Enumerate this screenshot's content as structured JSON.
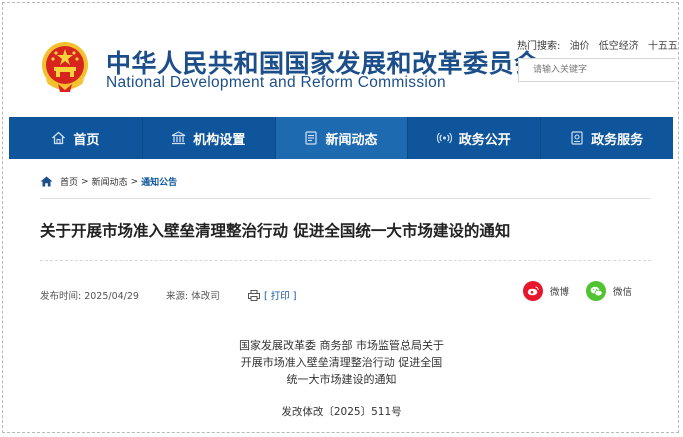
{
  "header": {
    "site_name_cn": "中华人民共和国国家发展和改革委员会",
    "site_name_en": "National Development and Reform Commission",
    "hot_label": "热门搜索:",
    "hot_keywords": [
      "油价",
      "低空经济",
      "十五五"
    ],
    "search_placeholder": "请输入关键字"
  },
  "nav": {
    "items": [
      {
        "label": "首页",
        "icon": "home-icon"
      },
      {
        "label": "机构设置",
        "icon": "institution-icon"
      },
      {
        "label": "新闻动态",
        "icon": "news-icon"
      },
      {
        "label": "政务公开",
        "icon": "broadcast-icon"
      },
      {
        "label": "政务服务",
        "icon": "service-icon"
      }
    ],
    "active_index": 2
  },
  "breadcrumb": {
    "items": [
      "首页",
      "新闻动态",
      "通知公告"
    ],
    "separator": ">"
  },
  "article": {
    "title": "关于开展市场准入壁垒清理整治行动 促进全国统一大市场建设的通知",
    "date_label": "发布时间: 2025/04/29",
    "source_label": "来源: 体改司",
    "print_label": "[ 打印 ]",
    "share": [
      {
        "label": "微博",
        "icon": "weibo-icon",
        "color": "#e6162d"
      },
      {
        "label": "微信",
        "icon": "wechat-icon",
        "color": "#51c332"
      }
    ],
    "body_lines": [
      "国家发展改革委 商务部 市场监管总局关于",
      "开展市场准入壁垒清理整治行动 促进全国",
      "统一大市场建设的通知"
    ],
    "doc_number": "发改体改〔2025〕511号"
  },
  "colors": {
    "brand_blue": "#1c4f8a",
    "nav_blue": "#0e559c",
    "nav_active": "#1d6ab0"
  }
}
